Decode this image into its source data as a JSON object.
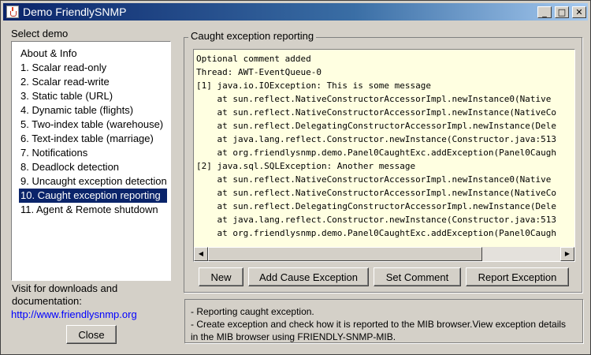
{
  "window": {
    "title": "Demo FriendlySNMP",
    "minimize_glyph": "_",
    "maximize_glyph": "□",
    "close_glyph": "✕"
  },
  "sidebar": {
    "label": "Select demo",
    "items": [
      {
        "label": "About & Info"
      },
      {
        "label": "1. Scalar read-only"
      },
      {
        "label": "2. Scalar read-write"
      },
      {
        "label": "3. Static table (URL)"
      },
      {
        "label": "4. Dynamic table (flights)"
      },
      {
        "label": "5. Two-index table (warehouse)"
      },
      {
        "label": "6. Text-index table (marriage)"
      },
      {
        "label": "7. Notifications"
      },
      {
        "label": "8. Deadlock detection"
      },
      {
        "label": "9. Uncaught exception detection"
      },
      {
        "label": "10. Caught exception reporting",
        "selected": true
      },
      {
        "label": "11. Agent & Remote shutdown"
      }
    ],
    "visit_text": "Visit for downloads and documentation:",
    "link": "http://www.friendlysnmp.org",
    "close_button": "Close"
  },
  "main": {
    "group_title": "Caught exception reporting",
    "log_lines": [
      "Optional comment added",
      "Thread: AWT-EventQueue-0",
      "[1] java.io.IOException: This is some message",
      "    at sun.reflect.NativeConstructorAccessorImpl.newInstance0(Native",
      "    at sun.reflect.NativeConstructorAccessorImpl.newInstance(NativeCo",
      "    at sun.reflect.DelegatingConstructorAccessorImpl.newInstance(Dele",
      "    at java.lang.reflect.Constructor.newInstance(Constructor.java:513",
      "    at org.friendlysnmp.demo.Panel0CaughtExc.addException(Panel0Caugh",
      "[2] java.sql.SQLException: Another message",
      "    at sun.reflect.NativeConstructorAccessorImpl.newInstance0(Native",
      "    at sun.reflect.NativeConstructorAccessorImpl.newInstance(NativeCo",
      "    at sun.reflect.DelegatingConstructorAccessorImpl.newInstance(Dele",
      "    at java.lang.reflect.Constructor.newInstance(Constructor.java:513",
      "    at org.friendlysnmp.demo.Panel0CaughtExc.addException(Panel0Caugh"
    ],
    "buttons": {
      "new": "New",
      "add_cause": "Add Cause Exception",
      "set_comment": "Set Comment",
      "report": "Report Exception"
    },
    "scroll_left_glyph": "◀",
    "scroll_right_glyph": "▶"
  },
  "info": {
    "line1": "- Reporting caught exception.",
    "line2": "- Create exception and check how it is reported to the MIB browser.View exception details",
    "line3": "in the MIB browser using FRIENDLY-SNMP-MIB."
  },
  "colors": {
    "titlebar": "#0a246a",
    "selection": "#0a246a",
    "text_area_bg": "#ffffe1",
    "link": "#0000ff"
  }
}
